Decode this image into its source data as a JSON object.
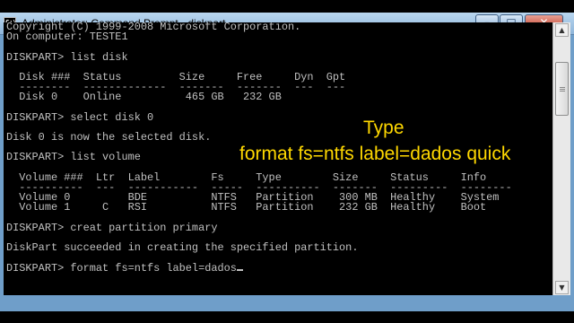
{
  "window": {
    "title": "Administrator: Command Prompt - diskpart",
    "icon_label": "C:\\",
    "buttons": {
      "minimize": "–",
      "maximize": "□",
      "close": "✕"
    }
  },
  "console": {
    "lines": [
      "Copyright (C) 1999-2008 Microsoft Corporation.",
      "On computer: TESTE1",
      "",
      "DISKPART> list disk",
      "",
      "  Disk ###  Status         Size     Free     Dyn  Gpt",
      "  --------  -------------  -------  -------  ---  ---",
      "  Disk 0    Online          465 GB   232 GB",
      "",
      "DISKPART> select disk 0",
      "",
      "Disk 0 is now the selected disk.",
      "",
      "DISKPART> list volume",
      "",
      "  Volume ###  Ltr  Label        Fs     Type        Size     Status     Info",
      "  ----------  ---  -----------  -----  ----------  -------  ---------  --------",
      "  Volume 0         BDE          NTFS   Partition    300 MB  Healthy    System",
      "  Volume 1     C   RSI          NTFS   Partition    232 GB  Healthy    Boot",
      "",
      "DISKPART> creat partition primary",
      "",
      "DiskPart succeeded in creating the specified partition.",
      "",
      "DISKPART> format fs=ntfs label=dados"
    ]
  },
  "overlay": {
    "line1": "Type",
    "line2": "format fs=ntfs label=dados quick"
  },
  "colors": {
    "console_bg": "#000000",
    "console_text": "#c0c0c0",
    "overlay_text": "#ffd800",
    "title_bar": "#a9c9e8",
    "close_button": "#c2412b"
  },
  "icons": {
    "app": "command-prompt-icon",
    "scroll_up": "arrow-up-icon",
    "scroll_down": "arrow-down-icon"
  }
}
